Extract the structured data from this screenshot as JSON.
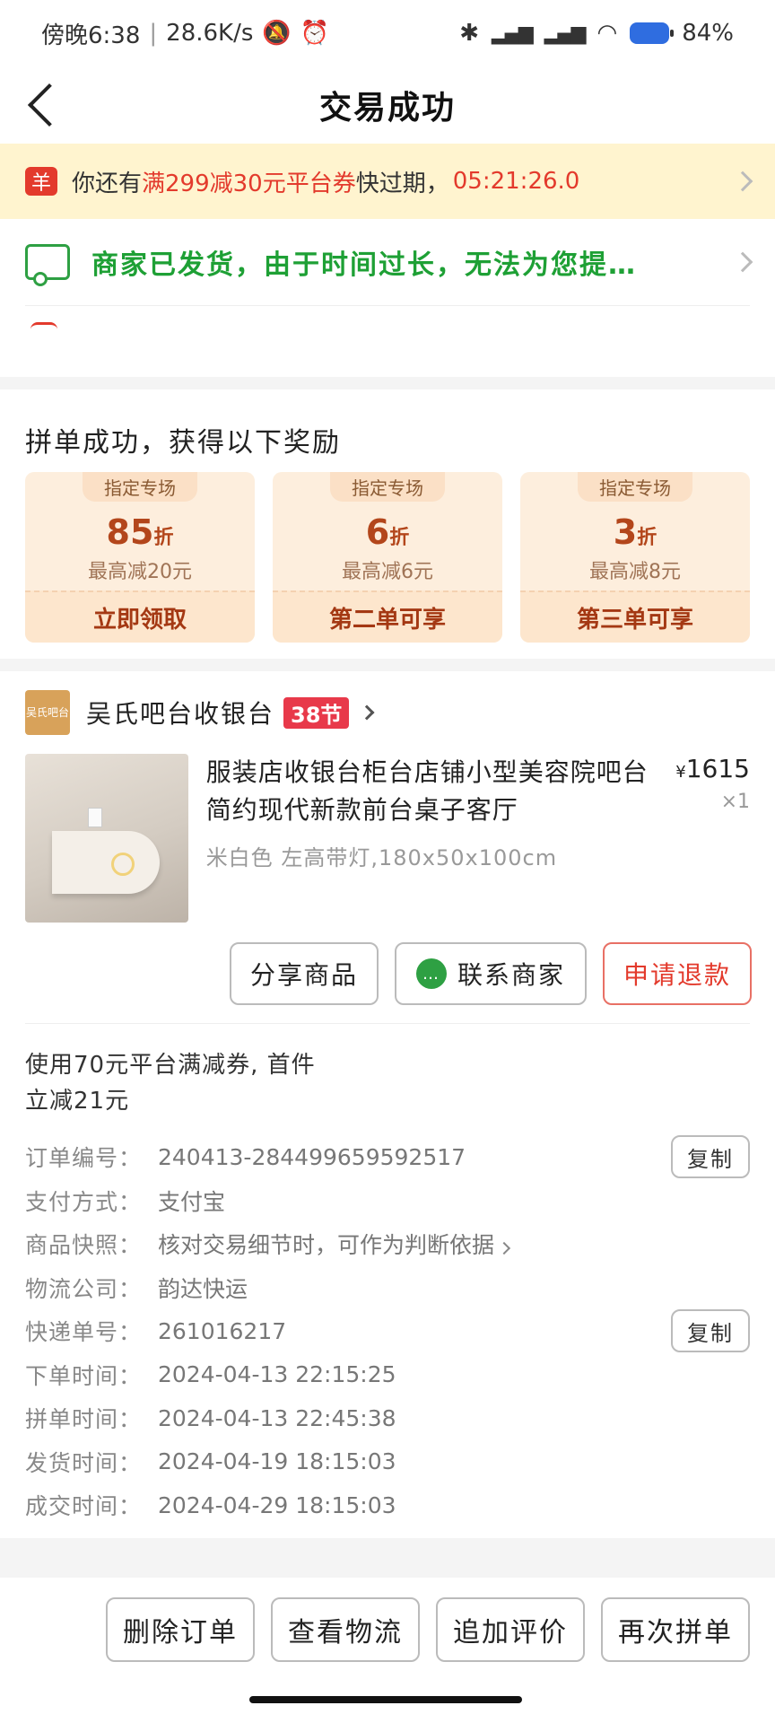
{
  "status_bar": {
    "time": "傍晚6:38",
    "speed": "28.6K/s",
    "battery": "84%",
    "icons": [
      "mute-icon",
      "alarm-icon",
      "bluetooth-icon",
      "signal-icon",
      "wifi-icon",
      "battery-icon"
    ]
  },
  "nav": {
    "title": "交易成功"
  },
  "coupon_bar": {
    "icon": "羊",
    "prefix": "你还有",
    "highlight": "满299减30元平台券",
    "suffix": "快过期，",
    "timer": "05:21:26.0"
  },
  "shipping": {
    "text": "商家已发货，由于时间过长，无法为您提…"
  },
  "reward": {
    "title": "拼单成功，获得以下奖励",
    "cards": [
      {
        "tag": "指定专场",
        "discount": "85",
        "unit": "折",
        "max": "最高减20元",
        "action": "立即领取"
      },
      {
        "tag": "指定专场",
        "discount": "6",
        "unit": "折",
        "max": "最高减6元",
        "action": "第二单可享"
      },
      {
        "tag": "指定专场",
        "discount": "3",
        "unit": "折",
        "max": "最高减8元",
        "action": "第三单可享"
      }
    ]
  },
  "shop": {
    "logo_text": "吴氏吧台",
    "name": "吴氏吧台收银台",
    "badge": "38节"
  },
  "goods": {
    "title": "服装店收银台柜台店铺小型美容院吧台简约现代新款前台桌子客厅",
    "spec": "米白色 左高带灯,180x50x100cm",
    "price_symbol": "¥",
    "price": "1615",
    "qty": "×1"
  },
  "actions": {
    "share": "分享商品",
    "contact": "联系商家",
    "refund": "申请退款"
  },
  "promo": {
    "line1": "使用70元平台满减券, 首件",
    "line2": "立减21元"
  },
  "info": {
    "order_no_label": "订单编号：",
    "order_no": "240413-284499659592517",
    "pay_label": "支付方式：",
    "pay": "支付宝",
    "snapshot_label": "商品快照：",
    "snapshot": "核对交易细节时，可作为判断依据",
    "logistics_label": "物流公司：",
    "logistics": "韵达快运",
    "tracking_label": "快递单号：",
    "tracking": "261016217",
    "order_time_label": "下单时间：",
    "order_time": "2024-04-13 22:15:25",
    "group_time_label": "拼单时间：",
    "group_time": "2024-04-13 22:45:38",
    "ship_time_label": "发货时间：",
    "ship_time": "2024-04-19 18:15:03",
    "done_time_label": "成交时间：",
    "done_time": "2024-04-29 18:15:03",
    "copy_label": "复制"
  },
  "bottom": {
    "delete": "删除订单",
    "logistics": "查看物流",
    "review": "追加评价",
    "rebuy": "再次拼单"
  },
  "colors": {
    "accent_red": "#e33a2c",
    "ship_green": "#1ea035",
    "coupon_bg": "#fff4cf"
  }
}
